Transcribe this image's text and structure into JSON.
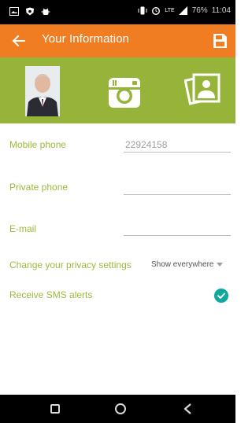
{
  "status_bar": {
    "time": "11:04",
    "battery": "76%",
    "network": "LTE",
    "left_icons": [
      "gallery-icon",
      "shield-icon",
      "bug-icon"
    ],
    "right_icons": [
      "vibrate-icon",
      "alarm-icon",
      "signal-icon",
      "battery-icon"
    ]
  },
  "app_bar": {
    "title": "Your Information",
    "back_icon": "arrow-left-icon",
    "save_icon": "save-icon",
    "color": "#f07d22"
  },
  "photo_band": {
    "color": "#96b43a",
    "actions": [
      "camera-icon",
      "gallery-icon"
    ]
  },
  "form": {
    "mobile": {
      "label": "Mobile phone",
      "value": "22924158"
    },
    "private": {
      "label": "Private phone",
      "value": ""
    },
    "email": {
      "label": "E-mail",
      "value": ""
    },
    "privacy": {
      "label": "Change your privacy settings",
      "selected": "Show everywhere"
    },
    "sms": {
      "label": "Receive SMS alerts",
      "checked": true
    },
    "label_color": "#9bbb3a",
    "check_color": "#13a89e"
  },
  "nav_bar": {
    "icons": [
      "recents-icon",
      "home-icon",
      "back-icon"
    ]
  }
}
